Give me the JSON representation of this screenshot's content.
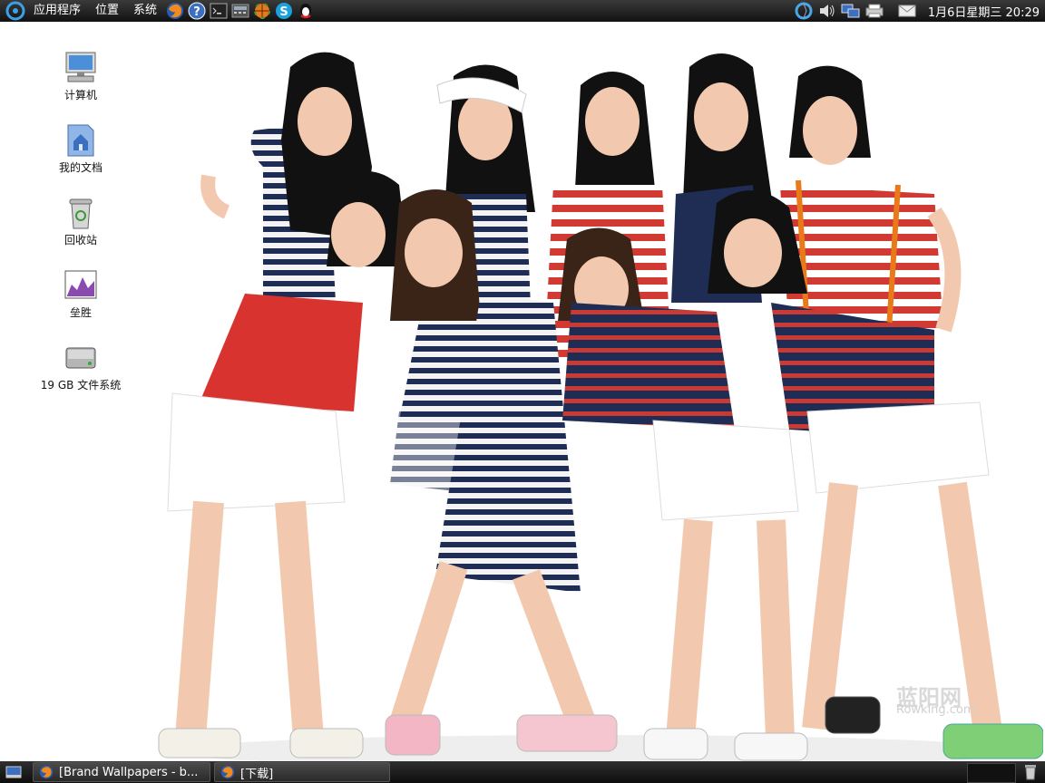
{
  "top_panel": {
    "menus": [
      "应用程序",
      "位置",
      "系统"
    ],
    "launchers": [
      "firefox-icon",
      "help-icon",
      "terminal-icon",
      "calculator-icon",
      "basketball-game-icon",
      "skype-icon",
      "qq-icon"
    ],
    "tray": [
      "network-manager-icon",
      "volume-icon",
      "display-icon",
      "printer-icon",
      "mail-icon"
    ],
    "clock": "1月6日星期三 20:29"
  },
  "desktop": {
    "icons": [
      {
        "label": "计算机",
        "icon": "computer-icon"
      },
      {
        "label": "我的文档",
        "icon": "home-folder-icon"
      },
      {
        "label": "回收站",
        "icon": "trash-icon"
      },
      {
        "label": "垒胜",
        "icon": "chart-app-icon"
      },
      {
        "label": "19 GB 文件系统",
        "icon": "drive-icon"
      }
    ],
    "watermark": "蓝阳网",
    "watermark_sub": "Rowking.com"
  },
  "bottom_panel": {
    "tasks": [
      {
        "label": "[Brand Wallpapers - b...",
        "icon": "firefox-icon"
      },
      {
        "label": "[下载]",
        "icon": "firefox-icon"
      }
    ]
  },
  "colors": {
    "panel": "#1a1a1a",
    "stripe_red": "#d03a33",
    "stripe_navy": "#1f2d55",
    "skin": "#f2c9ae"
  }
}
